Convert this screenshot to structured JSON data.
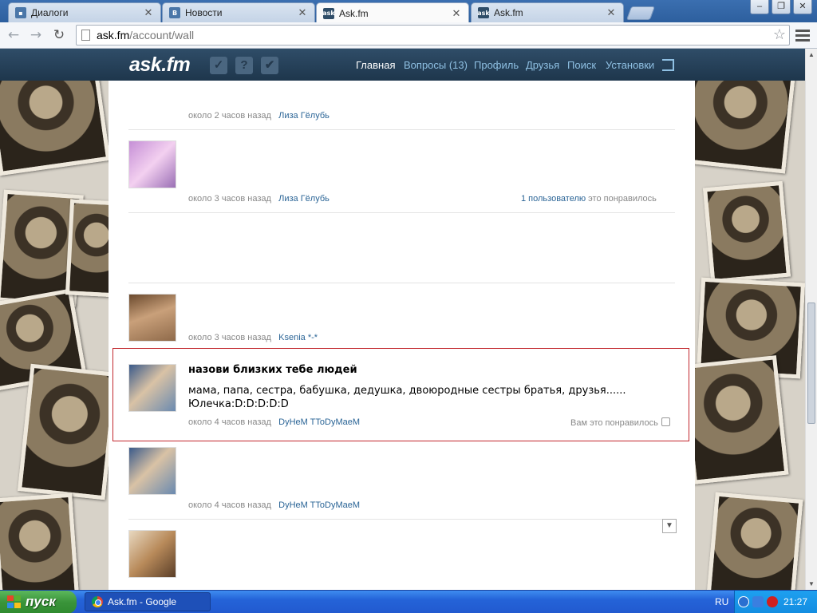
{
  "browser": {
    "tabs": [
      {
        "title": "Диалоги",
        "favicon_color": "#4a76a8"
      },
      {
        "title": "Новости",
        "favicon_color": "#4a76a8",
        "favicon_text": "B"
      },
      {
        "title": "Ask.fm",
        "favicon_color": "#2f4d68",
        "favicon_text": "ask"
      },
      {
        "title": "Ask.fm",
        "favicon_color": "#2f4d68",
        "favicon_text": "ask"
      }
    ],
    "active_tab": 2,
    "close_glyph": "✕",
    "address": {
      "host": "ask.fm",
      "path": "/account/wall"
    }
  },
  "site": {
    "logo_main": "ask",
    "logo_dot": ".",
    "logo_end": "fm",
    "nav": {
      "home": "Главная",
      "questions": "Вопросы (13)",
      "profile": "Профиль",
      "friends": "Друзья",
      "search": "Поиск",
      "settings": "Установки"
    },
    "colors": {
      "header": "#2f4d68",
      "link": "#2a6496",
      "nav_link": "#8fc0e3",
      "highlight_border": "#c2272d"
    }
  },
  "feed": [
    {
      "time": "около 2 часов назад",
      "author": "Лиза Гёлубь"
    },
    {
      "time": "около 3 часов назад",
      "author": "Лиза Гёлубь",
      "likes_link": "1 пользователю",
      "likes_rest": " это понравилось"
    },
    {
      "time": "около 3 часов назад",
      "author": "Ksenia *-*"
    },
    {
      "question": "назови близких тебе людей",
      "answer_line1": "мама, папа, сестра, бабушка, дедушка, двоюродные сестры братья, друзья......",
      "answer_line2": "Юлечка:D:D:D:D:D",
      "time": "около 4 часов назад",
      "author": "DyHeM TToDyMaeM",
      "likes_text": "Вам это понравилось"
    },
    {
      "time": "около 4 часов назад",
      "author": "DyHeM TToDyMaeM"
    }
  ],
  "taskbar": {
    "start_label": "пуск",
    "task_item": "Ask.fm - Google Chrome",
    "language": "RU",
    "clock": "21:27"
  }
}
